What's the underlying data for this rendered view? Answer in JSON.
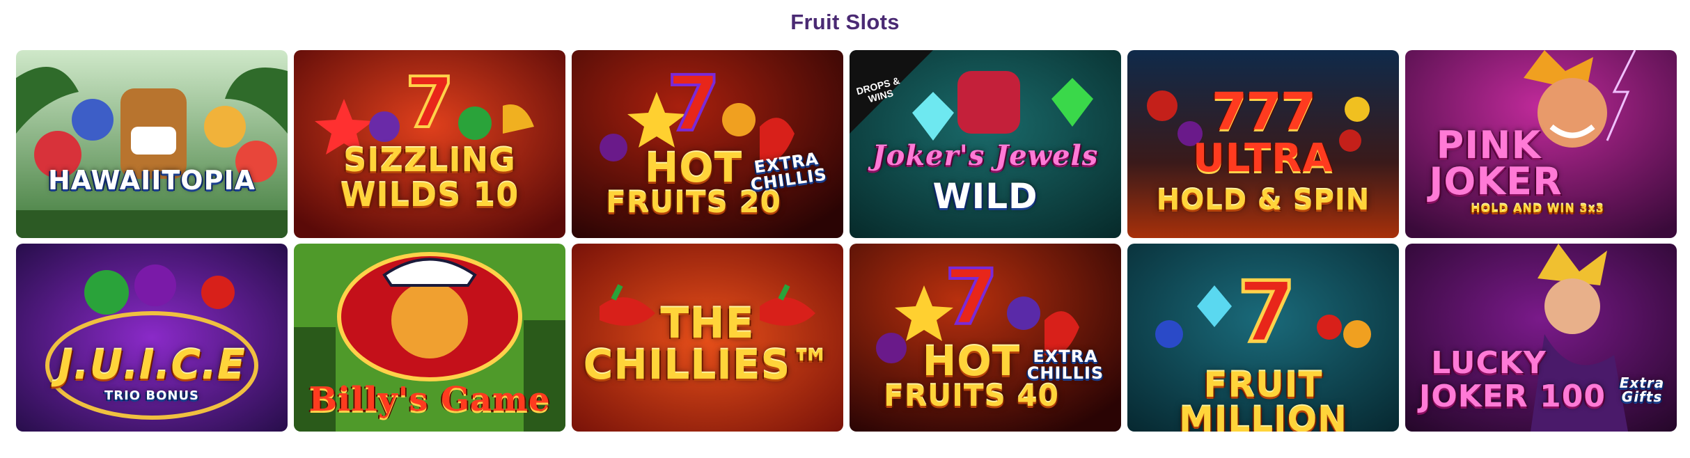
{
  "section": {
    "title": "Fruit Slots"
  },
  "games": [
    {
      "name": "HAWAIITOPIA",
      "line1": "HAWAIITOPIA"
    },
    {
      "name": "SIZZLING WILDS 10",
      "line1": "SIZZLING",
      "line2": "WILDS 10"
    },
    {
      "name": "HOT FRUITS 20 EXTRA CHILLIS",
      "line1": "HOT",
      "line2": "FRUITS 20",
      "tag": "EXTRA CHILLIS"
    },
    {
      "name": "Joker's Jewels WILD",
      "line1": "Joker's Jewels",
      "line2": "WILD",
      "badge": "DROPS & WINS"
    },
    {
      "name": "777 ULTRA HOLD & SPIN",
      "line1": "777",
      "line2": "ULTRA",
      "line3": "HOLD & SPIN"
    },
    {
      "name": "PINK JOKER HOLD AND WIN 3x3",
      "line1": "PINK",
      "line2": "JOKER",
      "line3": "HOLD AND WIN 3x3"
    },
    {
      "name": "J.U.I.C.E TRIO BONUS",
      "line1": "J.U.I.C.E",
      "line2": "TRIO BONUS"
    },
    {
      "name": "Billy's Game",
      "line1": "Billy's Game"
    },
    {
      "name": "THE CHILLIES",
      "line1": "THE",
      "line2": "CHILLIES™"
    },
    {
      "name": "HOT FRUITS 40 EXTRA CHILLIS",
      "line1": "HOT",
      "line2": "FRUITS 40",
      "tag": "EXTRA CHILLIS"
    },
    {
      "name": "FRUIT MILLION",
      "line1": "FRUIT MILLION"
    },
    {
      "name": "LUCKY JOKER 100 Extra Gifts",
      "line1": "LUCKY",
      "line2": "JOKER 100",
      "tag": "Extra Gifts"
    }
  ]
}
